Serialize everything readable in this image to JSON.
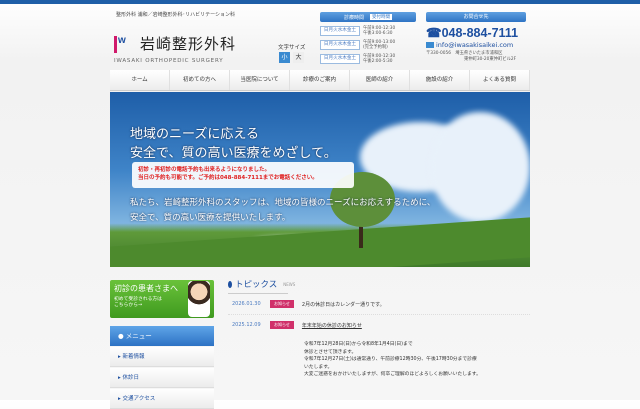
{
  "header": {
    "tagline": "整形外科 浦和／岩崎整形外科･リハビリテーション科",
    "logo_mark": "iw",
    "logo_name": "岩崎整形外科",
    "logo_en": "IWASAKI ORTHOPEDIC SURGERY",
    "font_size": {
      "label": "文字サイズ",
      "small": "小",
      "large": "大"
    },
    "hours": {
      "title": "診療時間",
      "tag": "受付時間",
      "rows": [
        {
          "days": "日月火水木金土",
          "times": [
            "午前9:00-12:30",
            "午後3:00-6:30"
          ]
        },
        {
          "days": "日月火水木金土",
          "times": [
            "午前9:00-13:00",
            "(完全予約制)"
          ]
        },
        {
          "days": "日月火水木金土",
          "times": [
            "午前9:00-12:30",
            "午後2:00-5:30"
          ]
        }
      ]
    },
    "contact": {
      "title": "お問合せ先",
      "phone": "☎048-884-7111",
      "email": "info@iwasakisaikei.com",
      "address1": "〒330-0056　埼玉県さいたま市浦和区",
      "address2": "東仲町30-20東仲町ビル2F"
    }
  },
  "nav": [
    "ホーム",
    "初めての方へ",
    "当医院について",
    "診療のご案内",
    "医師の紹介",
    "施設の紹介",
    "よくある質問"
  ],
  "hero": {
    "headline1": "地域のニーズに応える",
    "headline2": "安全で、質の高い医療をめざして。",
    "notice1": "初診・再初診の電話予約も出来るようになりました。",
    "notice2": "当日の予約も可能です。ご予約は048-884-7111までお電話ください。",
    "sub1": "私たち、岩崎整形外科のスタッフは、地域の皆様のニーズにお応えするために、",
    "sub2": "安全で、質の高い医療を提供いたします。"
  },
  "sidebar": {
    "banner_title": "初診の患者さまへ",
    "banner_sub1": "初めて受診される方は",
    "banner_sub2": "こちらから→",
    "menu_title": "● メニュー",
    "items": [
      "▸ 新着情報",
      "▸ 休診日",
      "▸ 交通アクセス"
    ]
  },
  "topics": {
    "title": "トピックス",
    "en": "NEWS",
    "items": [
      {
        "date": "2026.01.30",
        "badge": "お知らせ",
        "text": "2月の休診日はカレンダー通りです。"
      },
      {
        "date": "2025.12.09",
        "badge": "お知らせ",
        "text": "年末年始の休診のお知らせ"
      }
    ],
    "body": [
      "令和7年12月28日(日)から令和8年1月4日(日)まで",
      "休診とさせて頂きます。",
      "令和7年12月27日(土)は通常通り、午前診療12時30分、午後17時30分まで診療",
      "いたします。",
      "大変ご迷惑をおかけいたしますが、何卒ご理解のほどよろしくお願いいたします。"
    ]
  }
}
